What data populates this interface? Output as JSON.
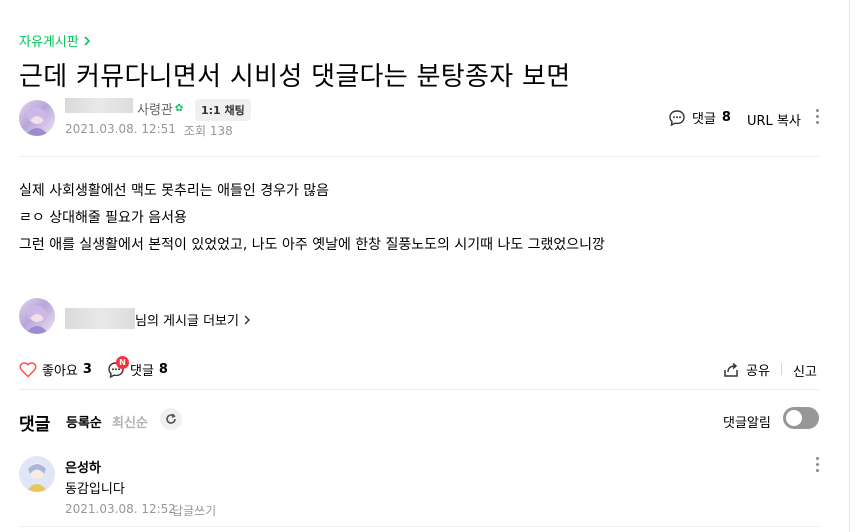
{
  "breadcrumb": {
    "category": "자유게시판"
  },
  "post": {
    "title": "근데 커뮤다니면서 시비성 댓글다는 분탕종자 보면",
    "author": {
      "rank": "사령관",
      "chat_label": "1:1 채팅"
    },
    "date": "2021.03.08. 12:51",
    "views": "조회 138",
    "comment_label": "댓글",
    "comment_count": "8",
    "url_copy": "URL 복사",
    "body": [
      "실제 사회생활에선 맥도 못추리는 애들인 경우가 많음",
      "ㄹㅇ 상대해줄 필요가 음서용",
      "그런 애를 실생활에서 본적이 있었었고, 나도 아주 옛날에 한창 질풍노도의 시기때 나도 그랬었으니깡"
    ],
    "more_posts": "님의 게시글 더보기"
  },
  "actions": {
    "like_label": "좋아요",
    "like_count": "3",
    "comment_label": "댓글",
    "comment_count": "8",
    "new_badge": "N",
    "share": "공유",
    "report": "신고"
  },
  "comments_section": {
    "heading": "댓글",
    "sort_registered": "등록순",
    "sort_latest": "최신순",
    "alarm_label": "댓글알림",
    "alarm_on": false,
    "items": [
      {
        "author": "은성하",
        "text": "동감입니다",
        "date": "2021.03.08. 12:52",
        "reply_label": "답글쓰기"
      }
    ]
  },
  "colors": {
    "accent": "#03c75a",
    "like": "#ff4d4f",
    "badge": "#ff2e3b",
    "muted": "#979797"
  }
}
